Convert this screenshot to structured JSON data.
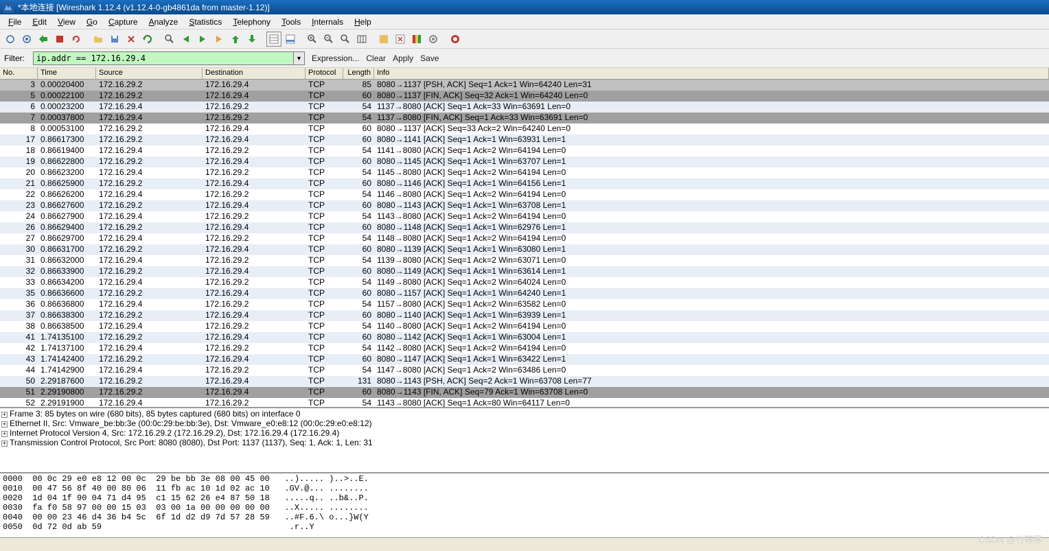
{
  "title": "*本地连接   [Wireshark 1.12.4  (v1.12.4-0-gb4861da from master-1.12)]",
  "menu": [
    "File",
    "Edit",
    "View",
    "Go",
    "Capture",
    "Analyze",
    "Statistics",
    "Telephony",
    "Tools",
    "Internals",
    "Help"
  ],
  "filter": {
    "label": "Filter:",
    "value": "ip.addr == 172.16.29.4",
    "expression": "Expression...",
    "clear": "Clear",
    "apply": "Apply",
    "save": "Save"
  },
  "columns": [
    "No.",
    "Time",
    "Source",
    "Destination",
    "Protocol",
    "Length",
    "Info"
  ],
  "packets": [
    {
      "no": "3",
      "time": "0.00020400",
      "src": "172.16.29.2",
      "dst": "172.16.29.4",
      "prot": "TCP",
      "len": "85",
      "info": "8080→1137 [PSH, ACK] Seq=1 Ack=1 Win=64240 Len=31",
      "cls": "sel"
    },
    {
      "no": "5",
      "time": "0.00022100",
      "src": "172.16.29.2",
      "dst": "172.16.29.4",
      "prot": "TCP",
      "len": "60",
      "info": "8080→1137 [FIN, ACK] Seq=32 Ack=1 Win=64240 Len=0",
      "cls": "dark"
    },
    {
      "no": "6",
      "time": "0.00023200",
      "src": "172.16.29.4",
      "dst": "172.16.29.2",
      "prot": "TCP",
      "len": "54",
      "info": "1137→8080 [ACK] Seq=1 Ack=33 Win=63691 Len=0",
      "cls": "light"
    },
    {
      "no": "7",
      "time": "0.00037800",
      "src": "172.16.29.4",
      "dst": "172.16.29.2",
      "prot": "TCP",
      "len": "54",
      "info": "1137→8080 [FIN, ACK] Seq=1 Ack=33 Win=63691 Len=0",
      "cls": "dark"
    },
    {
      "no": "8",
      "time": "0.00053100",
      "src": "172.16.29.2",
      "dst": "172.16.29.4",
      "prot": "TCP",
      "len": "60",
      "info": "8080→1137 [ACK] Seq=33 Ack=2 Win=64240 Len=0",
      "cls": ""
    },
    {
      "no": "17",
      "time": "0.86617300",
      "src": "172.16.29.2",
      "dst": "172.16.29.4",
      "prot": "TCP",
      "len": "60",
      "info": "8080→1141 [ACK] Seq=1 Ack=1 Win=63931 Len=1",
      "cls": "light"
    },
    {
      "no": "18",
      "time": "0.86619400",
      "src": "172.16.29.4",
      "dst": "172.16.29.2",
      "prot": "TCP",
      "len": "54",
      "info": "1141→8080 [ACK] Seq=1 Ack=2 Win=64194 Len=0",
      "cls": ""
    },
    {
      "no": "19",
      "time": "0.86622800",
      "src": "172.16.29.2",
      "dst": "172.16.29.4",
      "prot": "TCP",
      "len": "60",
      "info": "8080→1145 [ACK] Seq=1 Ack=1 Win=63707 Len=1",
      "cls": "light"
    },
    {
      "no": "20",
      "time": "0.86623200",
      "src": "172.16.29.4",
      "dst": "172.16.29.2",
      "prot": "TCP",
      "len": "54",
      "info": "1145→8080 [ACK] Seq=1 Ack=2 Win=64194 Len=0",
      "cls": ""
    },
    {
      "no": "21",
      "time": "0.86625900",
      "src": "172.16.29.2",
      "dst": "172.16.29.4",
      "prot": "TCP",
      "len": "60",
      "info": "8080→1146 [ACK] Seq=1 Ack=1 Win=64156 Len=1",
      "cls": "light"
    },
    {
      "no": "22",
      "time": "0.86626200",
      "src": "172.16.29.4",
      "dst": "172.16.29.2",
      "prot": "TCP",
      "len": "54",
      "info": "1146→8080 [ACK] Seq=1 Ack=2 Win=64194 Len=0",
      "cls": ""
    },
    {
      "no": "23",
      "time": "0.86627600",
      "src": "172.16.29.2",
      "dst": "172.16.29.4",
      "prot": "TCP",
      "len": "60",
      "info": "8080→1143 [ACK] Seq=1 Ack=1 Win=63708 Len=1",
      "cls": "light"
    },
    {
      "no": "24",
      "time": "0.86627900",
      "src": "172.16.29.4",
      "dst": "172.16.29.2",
      "prot": "TCP",
      "len": "54",
      "info": "1143→8080 [ACK] Seq=1 Ack=2 Win=64194 Len=0",
      "cls": ""
    },
    {
      "no": "26",
      "time": "0.86629400",
      "src": "172.16.29.2",
      "dst": "172.16.29.4",
      "prot": "TCP",
      "len": "60",
      "info": "8080→1148 [ACK] Seq=1 Ack=1 Win=62976 Len=1",
      "cls": "light"
    },
    {
      "no": "27",
      "time": "0.86629700",
      "src": "172.16.29.4",
      "dst": "172.16.29.2",
      "prot": "TCP",
      "len": "54",
      "info": "1148→8080 [ACK] Seq=1 Ack=2 Win=64194 Len=0",
      "cls": ""
    },
    {
      "no": "30",
      "time": "0.86631700",
      "src": "172.16.29.2",
      "dst": "172.16.29.4",
      "prot": "TCP",
      "len": "60",
      "info": "8080→1139 [ACK] Seq=1 Ack=1 Win=63080 Len=1",
      "cls": "light"
    },
    {
      "no": "31",
      "time": "0.86632000",
      "src": "172.16.29.4",
      "dst": "172.16.29.2",
      "prot": "TCP",
      "len": "54",
      "info": "1139→8080 [ACK] Seq=1 Ack=2 Win=63071 Len=0",
      "cls": ""
    },
    {
      "no": "32",
      "time": "0.86633900",
      "src": "172.16.29.2",
      "dst": "172.16.29.4",
      "prot": "TCP",
      "len": "60",
      "info": "8080→1149 [ACK] Seq=1 Ack=1 Win=63614 Len=1",
      "cls": "light"
    },
    {
      "no": "33",
      "time": "0.86634200",
      "src": "172.16.29.4",
      "dst": "172.16.29.2",
      "prot": "TCP",
      "len": "54",
      "info": "1149→8080 [ACK] Seq=1 Ack=2 Win=64024 Len=0",
      "cls": ""
    },
    {
      "no": "35",
      "time": "0.86636600",
      "src": "172.16.29.2",
      "dst": "172.16.29.4",
      "prot": "TCP",
      "len": "60",
      "info": "8080→1157 [ACK] Seq=1 Ack=1 Win=64240 Len=1",
      "cls": "light"
    },
    {
      "no": "36",
      "time": "0.86636800",
      "src": "172.16.29.4",
      "dst": "172.16.29.2",
      "prot": "TCP",
      "len": "54",
      "info": "1157→8080 [ACK] Seq=1 Ack=2 Win=63582 Len=0",
      "cls": ""
    },
    {
      "no": "37",
      "time": "0.86638300",
      "src": "172.16.29.2",
      "dst": "172.16.29.4",
      "prot": "TCP",
      "len": "60",
      "info": "8080→1140 [ACK] Seq=1 Ack=1 Win=63939 Len=1",
      "cls": "light"
    },
    {
      "no": "38",
      "time": "0.86638500",
      "src": "172.16.29.4",
      "dst": "172.16.29.2",
      "prot": "TCP",
      "len": "54",
      "info": "1140→8080 [ACK] Seq=1 Ack=2 Win=64194 Len=0",
      "cls": ""
    },
    {
      "no": "41",
      "time": "1.74135100",
      "src": "172.16.29.2",
      "dst": "172.16.29.4",
      "prot": "TCP",
      "len": "60",
      "info": "8080→1142 [ACK] Seq=1 Ack=1 Win=63004 Len=1",
      "cls": "light"
    },
    {
      "no": "42",
      "time": "1.74137100",
      "src": "172.16.29.4",
      "dst": "172.16.29.2",
      "prot": "TCP",
      "len": "54",
      "info": "1142→8080 [ACK] Seq=1 Ack=2 Win=64194 Len=0",
      "cls": ""
    },
    {
      "no": "43",
      "time": "1.74142400",
      "src": "172.16.29.2",
      "dst": "172.16.29.4",
      "prot": "TCP",
      "len": "60",
      "info": "8080→1147 [ACK] Seq=1 Ack=1 Win=63422 Len=1",
      "cls": "light"
    },
    {
      "no": "44",
      "time": "1.74142900",
      "src": "172.16.29.4",
      "dst": "172.16.29.2",
      "prot": "TCP",
      "len": "54",
      "info": "1147→8080 [ACK] Seq=1 Ack=2 Win=63486 Len=0",
      "cls": ""
    },
    {
      "no": "50",
      "time": "2.29187600",
      "src": "172.16.29.2",
      "dst": "172.16.29.4",
      "prot": "TCP",
      "len": "131",
      "info": "8080→1143 [PSH, ACK] Seq=2 Ack=1 Win=63708 Len=77",
      "cls": "light"
    },
    {
      "no": "51",
      "time": "2.29190800",
      "src": "172.16.29.2",
      "dst": "172.16.29.4",
      "prot": "TCP",
      "len": "60",
      "info": "8080→1143 [FIN, ACK] Seq=79 Ack=1 Win=63708 Len=0",
      "cls": "dark"
    },
    {
      "no": "52",
      "time": "2.29191900",
      "src": "172.16.29.4",
      "dst": "172.16.29.2",
      "prot": "TCP",
      "len": "54",
      "info": "1143→8080 [ACK] Seq=1 Ack=80 Win=64117 Len=0",
      "cls": ""
    }
  ],
  "details": [
    "Frame 3: 85 bytes on wire (680 bits), 85 bytes captured (680 bits) on interface 0",
    "Ethernet II, Src: Vmware_be:bb:3e (00:0c:29:be:bb:3e), Dst: Vmware_e0:e8:12 (00:0c:29:e0:e8:12)",
    "Internet Protocol Version 4, Src: 172.16.29.2 (172.16.29.2), Dst: 172.16.29.4 (172.16.29.4)",
    "Transmission Control Protocol, Src Port: 8080 (8080), Dst Port: 1137 (1137), Seq: 1, Ack: 1, Len: 31"
  ],
  "hex": [
    "0000  00 0c 29 e0 e8 12 00 0c  29 be bb 3e 08 00 45 00   ..)..... )..>..E.",
    "0010  00 47 56 8f 40 00 80 06  11 fb ac 10 1d 02 ac 10   .GV.@... ........",
    "0020  1d 04 1f 90 04 71 d4 95  c1 15 62 26 e4 87 50 18   .....q.. ..b&..P.",
    "0030  fa f0 58 97 00 00 15 03  03 00 1a 00 00 00 00 00   ..X..... ........",
    "0040  00 00 23 46 d4 36 b4 5c  6f 1d d2 d9 7d 57 28 59   ..#F.6.\\ o...}W(Y",
    "0050  0d 72 0d ab 59                                      .r..Y"
  ],
  "watermark": "CSDN @竹等寒"
}
